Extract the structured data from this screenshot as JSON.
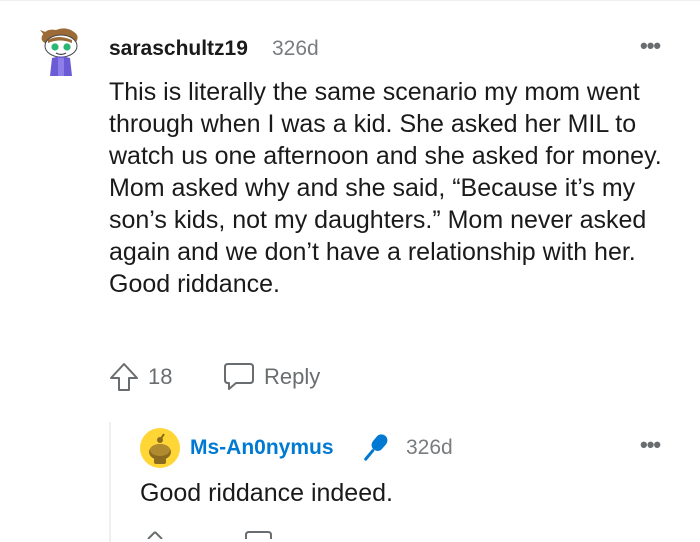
{
  "comment": {
    "username": "saraschultz19",
    "age": "326d",
    "more": "•••",
    "body": "This is literally the same scenario my mom went through when I was a kid. She asked her MIL to watch us one afternoon and she asked for money. Mom asked why and she said, “Because it’s my son’s kids, not my daughters.” Mom never asked again and we don’t have a relationship with her. Good riddance.",
    "upvotes": "18",
    "reply_label": "Reply",
    "icons": {
      "avatar": "snoo-avatar-icon",
      "upvote": "upvote-arrow-icon",
      "reply": "speech-bubble-icon",
      "more": "more-options-icon"
    }
  },
  "reply": {
    "username": "Ms-An0nymus",
    "age": "326d",
    "more": "•••",
    "body": "Good riddance indeed.",
    "icons": {
      "avatar": "yellow-snoo-avatar-icon",
      "badge": "microphone-icon"
    }
  },
  "colors": {
    "username_link": "#0079d3",
    "muted": "#787c7e",
    "text": "#1a1a1b",
    "mic": "#0079d3",
    "avatar_bg": "#ffd635"
  }
}
